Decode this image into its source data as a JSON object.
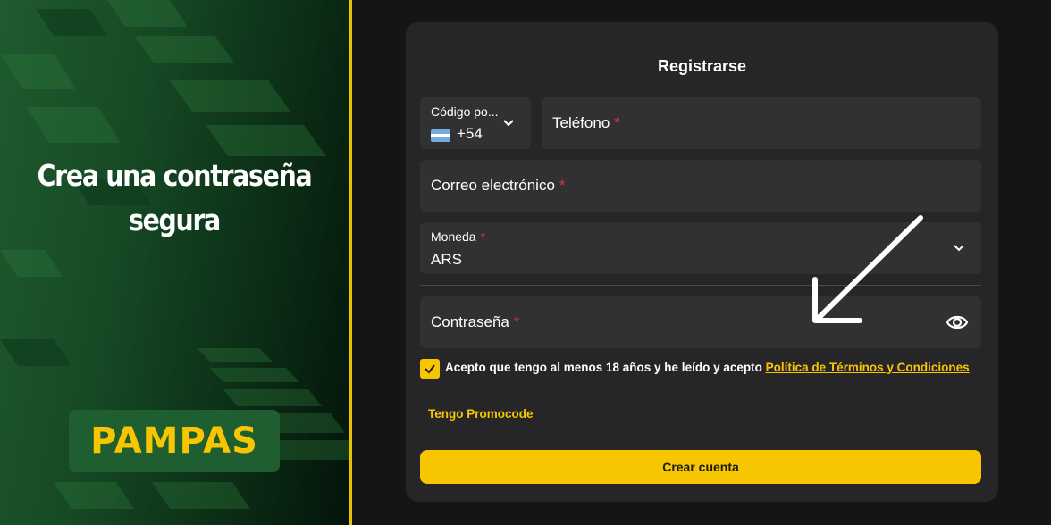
{
  "promo": {
    "title": "Crea una contraseña segura",
    "logo_text": "PAMPAS"
  },
  "form": {
    "title": "Registrarse",
    "country_code": {
      "label": "Código po...",
      "value": "+54",
      "flag": "argentina-flag"
    },
    "phone": {
      "label": "Teléfono",
      "required_mark": "*"
    },
    "email": {
      "label": "Correo electrónico",
      "required_mark": "*"
    },
    "currency": {
      "label": "Moneda",
      "required_mark": "*",
      "value": "ARS"
    },
    "password": {
      "label": "Contraseña",
      "required_mark": "*",
      "icon": "eye-icon"
    },
    "terms": {
      "checked": true,
      "text": "Acepto que tengo al menos 18 años y he leído y acepto",
      "link": "Política de Términos y Condiciones"
    },
    "promocode_link": "Tengo Promocode",
    "submit_label": "Crear cuenta"
  },
  "colors": {
    "accent": "#f7c600",
    "background": "#151515",
    "card": "#262628",
    "field": "#313134",
    "required": "#e0313b",
    "promo_green": "#1e5e30"
  }
}
